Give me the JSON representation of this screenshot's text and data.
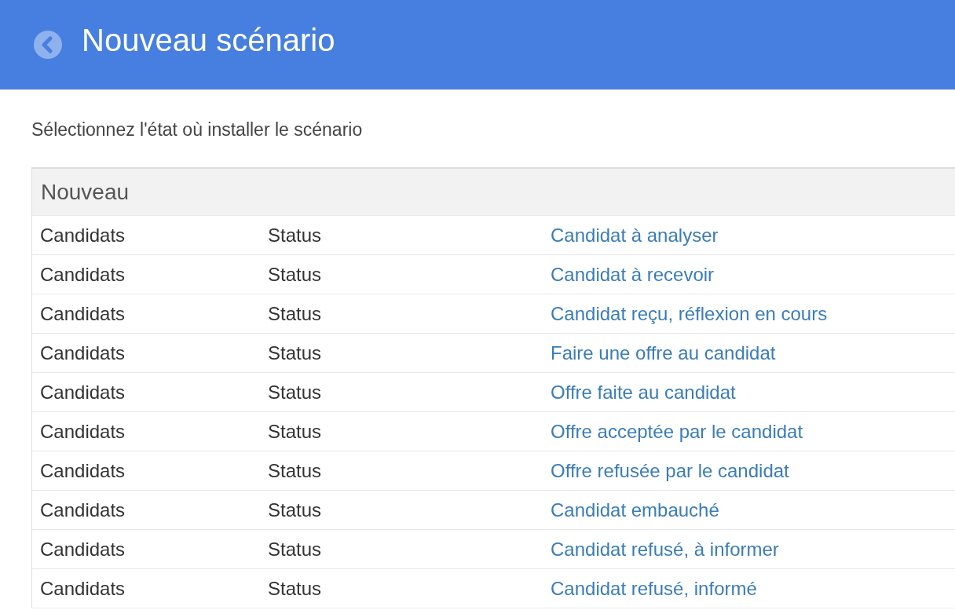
{
  "header": {
    "title": "Nouveau scénario"
  },
  "instruction": "Sélectionnez l'état où installer le scénario",
  "group": {
    "label": "Nouveau"
  },
  "rows": [
    {
      "entity": "Candidats",
      "field": "Status",
      "state": "Candidat à analyser"
    },
    {
      "entity": "Candidats",
      "field": "Status",
      "state": "Candidat à recevoir"
    },
    {
      "entity": "Candidats",
      "field": "Status",
      "state": "Candidat reçu, réflexion en cours"
    },
    {
      "entity": "Candidats",
      "field": "Status",
      "state": "Faire une offre au candidat"
    },
    {
      "entity": "Candidats",
      "field": "Status",
      "state": "Offre faite au candidat"
    },
    {
      "entity": "Candidats",
      "field": "Status",
      "state": "Offre acceptée par le candidat"
    },
    {
      "entity": "Candidats",
      "field": "Status",
      "state": "Offre refusée par le candidat"
    },
    {
      "entity": "Candidats",
      "field": "Status",
      "state": "Candidat embauché"
    },
    {
      "entity": "Candidats",
      "field": "Status",
      "state": "Candidat refusé, à informer"
    },
    {
      "entity": "Candidats",
      "field": "Status",
      "state": "Candidat refusé, informé"
    }
  ]
}
